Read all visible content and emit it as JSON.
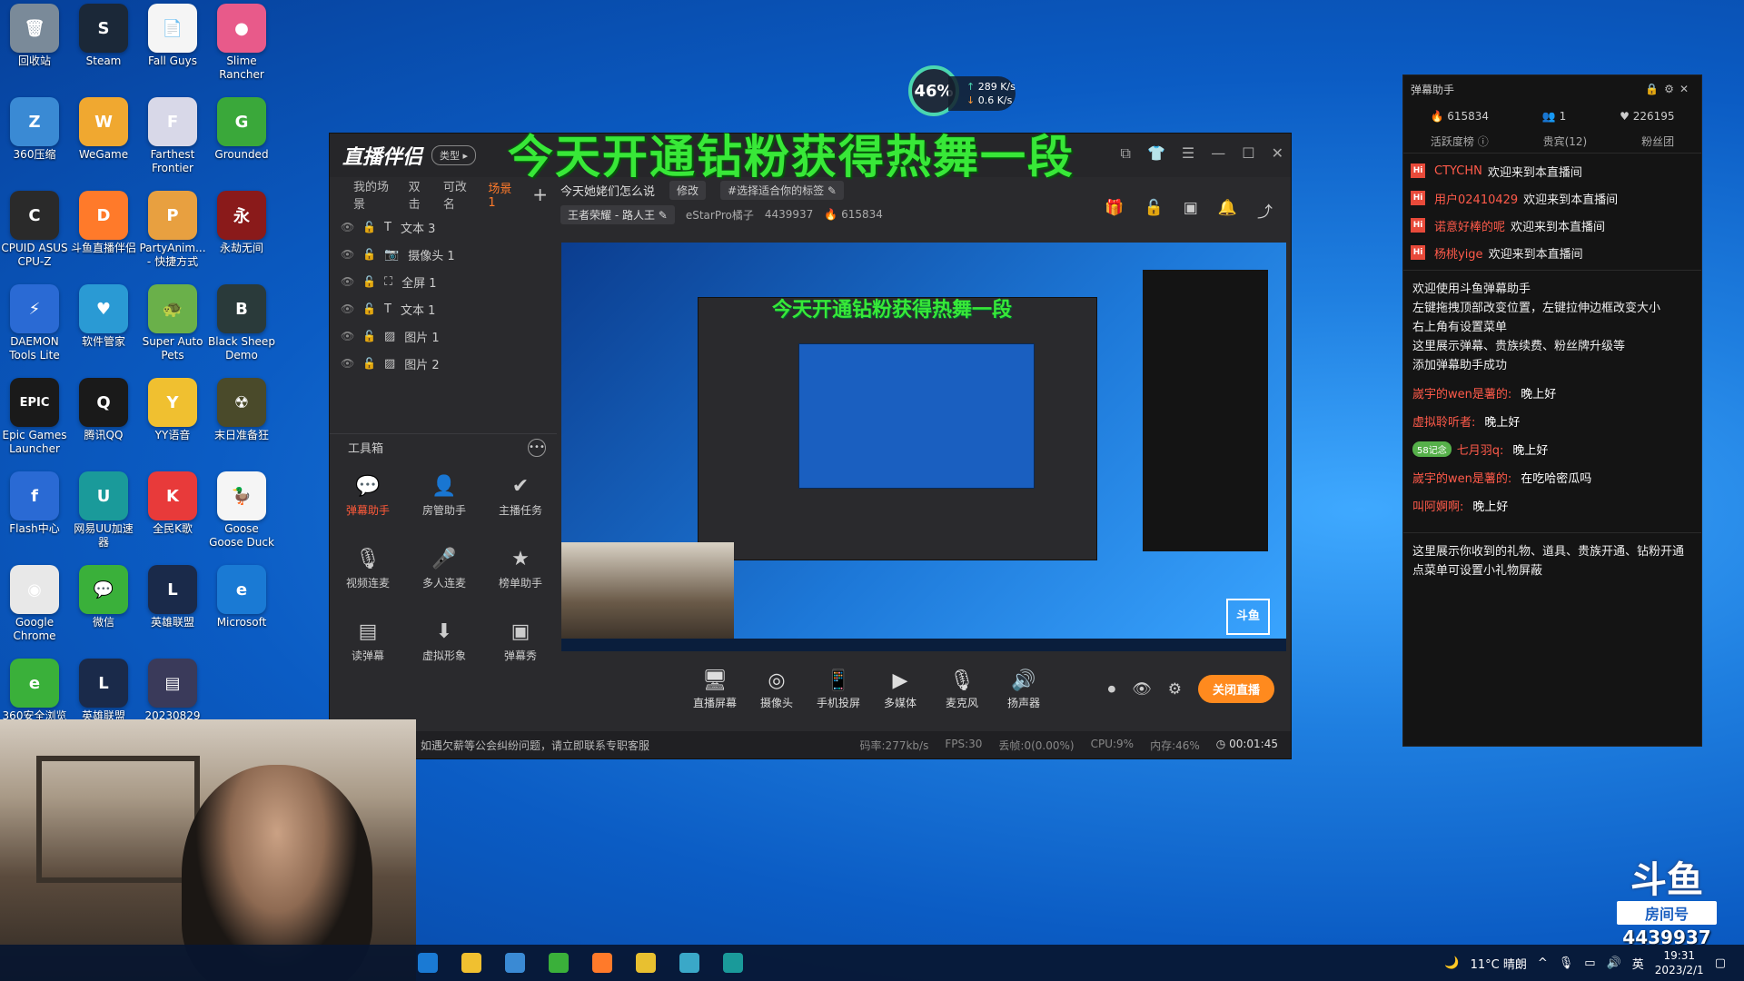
{
  "desktop_icons": [
    {
      "label": "回收站",
      "color": "#7a8a99",
      "glyph": "🗑"
    },
    {
      "label": "Steam",
      "color": "#1b2838",
      "glyph": "S"
    },
    {
      "label": "Fall Guys",
      "color": "#f5f5f5",
      "glyph": "📄"
    },
    {
      "label": "Slime Rancher",
      "color": "#e85a8a",
      "glyph": "●"
    },
    {
      "label": "360压缩",
      "color": "#3a8ad4",
      "glyph": "Z"
    },
    {
      "label": "WeGame",
      "color": "#f0a830",
      "glyph": "W"
    },
    {
      "label": "Farthest Frontier",
      "color": "#d8d8e8",
      "glyph": "F"
    },
    {
      "label": "Grounded",
      "color": "#3aa83a",
      "glyph": "G"
    },
    {
      "label": "CPUID ASUS CPU-Z",
      "color": "#2a2a2a",
      "glyph": "C"
    },
    {
      "label": "斗鱼直播伴侣",
      "color": "#ff7a2a",
      "glyph": "D"
    },
    {
      "label": "PartyAnim... - 快捷方式",
      "color": "#e8a040",
      "glyph": "P"
    },
    {
      "label": "永劫无间",
      "color": "#8a1a1a",
      "glyph": "永"
    },
    {
      "label": "DAEMON Tools Lite",
      "color": "#2a6ad4",
      "glyph": "⚡"
    },
    {
      "label": "软件管家",
      "color": "#2a9ad4",
      "glyph": "♥"
    },
    {
      "label": "Super Auto Pets",
      "color": "#6ab04a",
      "glyph": "🐢"
    },
    {
      "label": "Black Sheep Demo",
      "color": "#2a3a3a",
      "glyph": "B"
    },
    {
      "label": "Epic Games Launcher",
      "color": "#1a1a1a",
      "glyph": "EPIC"
    },
    {
      "label": "腾讯QQ",
      "color": "#1a1a1a",
      "glyph": "Q"
    },
    {
      "label": "YY语音",
      "color": "#f0c030",
      "glyph": "Y"
    },
    {
      "label": "末日准备狂",
      "color": "#4a4a2a",
      "glyph": "☢"
    },
    {
      "label": "Flash中心",
      "color": "#2a6ad4",
      "glyph": "f"
    },
    {
      "label": "网易UU加速器",
      "color": "#1a9a9a",
      "glyph": "U"
    },
    {
      "label": "全民K歌",
      "color": "#e83a3a",
      "glyph": "K"
    },
    {
      "label": "Goose Goose Duck",
      "color": "#f5f5f5",
      "glyph": "🦆"
    },
    {
      "label": "Google Chrome",
      "color": "#e8e8e8",
      "glyph": "◉"
    },
    {
      "label": "微信",
      "color": "#3ab03a",
      "glyph": "💬"
    },
    {
      "label": "英雄联盟",
      "color": "#1a2a4a",
      "glyph": "L"
    },
    {
      "label": "Microsoft",
      "color": "#1a7ad4",
      "glyph": "e"
    },
    {
      "label": "360安全浏览",
      "color": "#3ab03a",
      "glyph": "e"
    },
    {
      "label": "英雄联盟",
      "color": "#1a2a4a",
      "glyph": "L"
    },
    {
      "label": "20230829",
      "color": "#3a3a5a",
      "glyph": "▤"
    }
  ],
  "perf_float": {
    "cpu": "46%",
    "up": "289 K/s",
    "down": "0.6 K/s"
  },
  "main_window": {
    "logo": "直播伴侣",
    "type_badge": "类型",
    "overlay_text": "今天开通钻粉获得热舞一段",
    "scene_tabs": [
      "我的场景",
      "双击",
      "可改名",
      "场景 1"
    ],
    "layers": [
      {
        "icon": "T",
        "name": "文本 3"
      },
      {
        "icon": "📷",
        "name": "摄像头 1"
      },
      {
        "icon": "⛶",
        "name": "全屏 1"
      },
      {
        "icon": "T",
        "name": "文本 1"
      },
      {
        "icon": "▨",
        "name": "图片 1"
      },
      {
        "icon": "▨",
        "name": "图片 2"
      }
    ],
    "toolbox_title": "工具箱",
    "tools": [
      {
        "name": "弹幕助手",
        "icon": "💬",
        "active": true
      },
      {
        "name": "房管助手",
        "icon": "👤",
        "active": false
      },
      {
        "name": "主播任务",
        "icon": "✔",
        "active": false
      },
      {
        "name": "视频连麦",
        "icon": "🎙",
        "active": false
      },
      {
        "name": "多人连麦",
        "icon": "🎤",
        "active": false
      },
      {
        "name": "榜单助手",
        "icon": "★",
        "active": false
      },
      {
        "name": "读弹幕",
        "icon": "▤",
        "active": false
      },
      {
        "name": "虚拟形象",
        "icon": "⬇",
        "active": false
      },
      {
        "name": "弹幕秀",
        "icon": "▣",
        "active": false
      }
    ],
    "stream_title": "今天她姥们怎么说",
    "edit_label": "修改",
    "tag_label": "#选择适合你的标签",
    "category": "王者荣耀 - 路人王",
    "streamer_name": "eStarPro橘子",
    "room_id": "4439937",
    "hot_value": "615834",
    "bottom_tools": [
      {
        "name": "直播屏幕",
        "icon": "🖥"
      },
      {
        "name": "摄像头",
        "icon": "◎"
      },
      {
        "name": "手机投屏",
        "icon": "📱"
      },
      {
        "name": "多媒体",
        "icon": "▶"
      },
      {
        "name": "麦克风",
        "icon": "🎙"
      },
      {
        "name": "扬声器",
        "icon": "🔊"
      }
    ],
    "stop_button": "关闭直播",
    "status_notice": "如遇欠薪等公会纠纷问题，请立即联系专职客服",
    "status_bitrate": "码率:277kb/s",
    "status_fps": "FPS:30",
    "status_drop": "丢帧:0(0.00%)",
    "status_cpu": "CPU:9%",
    "status_mem": "内存:46%",
    "status_time": "00:01:45",
    "preview_overlay": "今天开通钻粉获得热舞一段",
    "preview_watermark": "斗鱼"
  },
  "chat_panel": {
    "title": "弹幕助手",
    "hot": "615834",
    "viewers": "1",
    "followers": "226195",
    "tabs": [
      "活跃度榜",
      "贵宾(12)",
      "粉丝团"
    ],
    "welcomes": [
      {
        "name": "CTYCHN",
        "text": "欢迎来到本直播间"
      },
      {
        "name": "用户02410429",
        "text": "欢迎来到本直播间"
      },
      {
        "name": "诺意好棒的呢",
        "text": "欢迎来到本直播间"
      },
      {
        "name": "杨桃yige",
        "text": "欢迎来到本直播间"
      }
    ],
    "sys_msgs": [
      "欢迎使用斗鱼弹幕助手",
      "左键拖拽顶部改变位置，左键拉伸边框改变大小",
      "右上角有设置菜单",
      "这里展示弹幕、贵族续费、粉丝牌升级等",
      "添加弹幕助手成功"
    ],
    "chats": [
      {
        "name": "嵗宇的wen是薯的:",
        "text": "晚上好",
        "badge": ""
      },
      {
        "name": "虚拟聆听者:",
        "text": "晚上好",
        "badge": ""
      },
      {
        "name": "七月羽q:",
        "text": "晚上好",
        "badge": "58记念"
      },
      {
        "name": "嵗宇的wen是薯的:",
        "text": "在吃哈密瓜吗",
        "badge": ""
      },
      {
        "name": "叫阿婀啊:",
        "text": "晚上好",
        "badge": ""
      }
    ],
    "gift_notes": [
      "这里展示你收到的礼物、道具、贵族开通、钻粉开通",
      "点菜单可设置小礼物屏蔽"
    ]
  },
  "taskbar": {
    "weather": "11°C 晴朗",
    "ime": "英",
    "time": "19:31",
    "date": "2023/2/1",
    "apps": [
      "#1a7ad4",
      "#f0c030",
      "#3a8ad4",
      "#3ab03a",
      "#ff7a2a",
      "#e8c030",
      "#3aa8c8",
      "#1a9a9a"
    ]
  },
  "watermark": {
    "logo": "斗鱼",
    "sub": "房间号",
    "room": "4439937"
  }
}
